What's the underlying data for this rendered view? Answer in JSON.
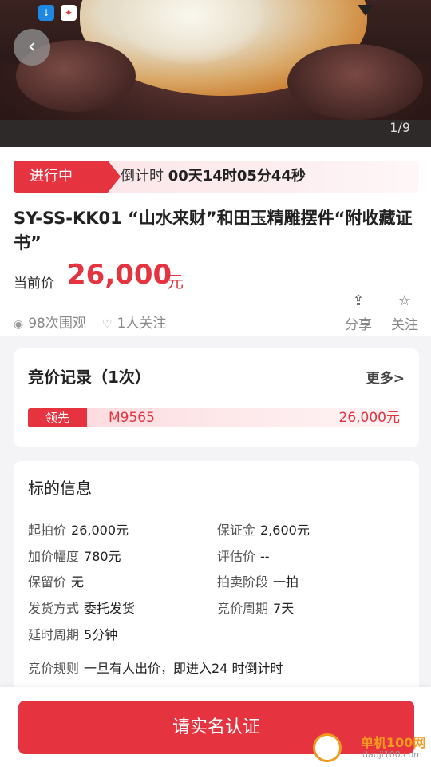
{
  "hero": {
    "pager": "1/9"
  },
  "status": {
    "tag": "进行中",
    "countdown_prefix": "倒计时",
    "countdown_value": "00天14时05分44秒"
  },
  "lot": {
    "title": "SY-SS-KK01 “山水来财”和田玉精雕摆件“附收藏证书”",
    "price_label": "当前价",
    "price_value": "26,000",
    "price_unit": "元",
    "views": "98次围观",
    "followers": "1人关注"
  },
  "actions": {
    "share": "分享",
    "follow": "关注"
  },
  "bids": {
    "title": "竞价记录（1次）",
    "more": "更多>",
    "rows": [
      {
        "badge": "领先",
        "user": "M9565",
        "price": "26,000元"
      }
    ]
  },
  "info": {
    "title": "标的信息",
    "items": [
      {
        "label": "起拍价",
        "value": "26,000元"
      },
      {
        "label": "保证金",
        "value": "2,600元"
      },
      {
        "label": "加价幅度",
        "value": "780元"
      },
      {
        "label": "评估价",
        "value": "--"
      },
      {
        "label": "保留价",
        "value": "无"
      },
      {
        "label": "拍卖阶段",
        "value": "一拍"
      },
      {
        "label": "发货方式",
        "value": "委托发货"
      },
      {
        "label": "竞价周期",
        "value": "7天"
      },
      {
        "label": "延时周期",
        "value": "5分钟"
      }
    ],
    "rule_label": "竞价规则",
    "rule_value": "一旦有人出价，即进入24 时倒计时"
  },
  "cta": {
    "label": "请实名认证"
  },
  "watermark": {
    "text": "单机100网",
    "url": "danji100.com"
  },
  "colors": {
    "accent": "#e53340",
    "background": "#f4f4f6"
  },
  "icons": [
    "back-icon",
    "download-icon",
    "app-icon",
    "wifi-icon",
    "eye-icon",
    "heart-icon",
    "share-icon",
    "star-icon"
  ]
}
